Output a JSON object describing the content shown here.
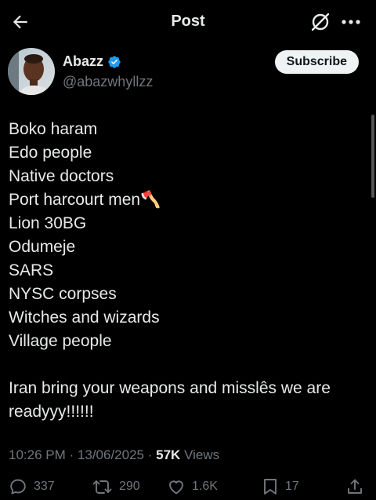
{
  "header": {
    "title": "Post"
  },
  "author": {
    "name": "Abazz",
    "handle": "@abazwhyllzz",
    "verified": true,
    "subscribe_label": "Subscribe"
  },
  "tweet": {
    "lines": [
      "Boko haram",
      "Edo people",
      "Native doctors",
      "Port harcourt men🪓",
      "Lion 30BG",
      "Odumeje",
      "SARS",
      "NYSC corpses",
      "Witches and wizards",
      "Village people",
      "",
      "Iran bring your weapons and misslês we are readyyy!!!!!!"
    ]
  },
  "meta": {
    "time": "10:26 PM",
    "date": "13/06/2025",
    "views": "57K",
    "views_label": "Views",
    "separator": "·"
  },
  "actions": {
    "replies": "337",
    "reposts": "290",
    "likes": "1.6K",
    "bookmarks": "17"
  },
  "colors": {
    "background": "#000000",
    "text": "#e7e9ea",
    "muted": "#71767b",
    "verified": "#1d9bf0"
  }
}
